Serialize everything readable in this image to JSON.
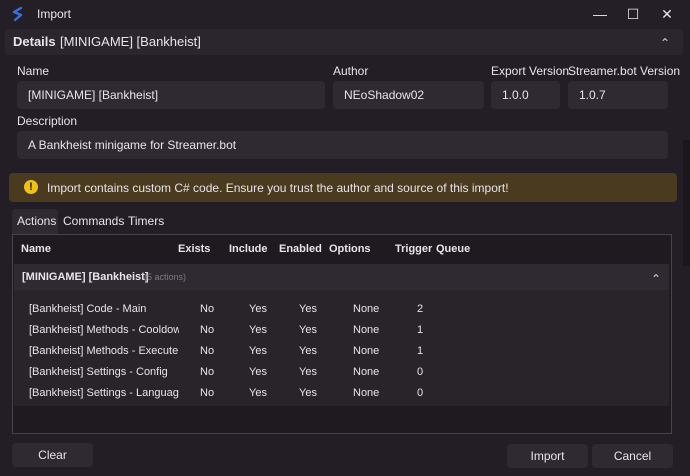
{
  "window": {
    "title": "Import",
    "minimize_glyph": "—",
    "maximize_glyph": "☐",
    "close_glyph": "✕"
  },
  "details": {
    "label": "Details",
    "name": "[MINIGAME] [Bankheist]",
    "collapse_glyph": "⌃"
  },
  "fields": {
    "name_label": "Name",
    "name_value": "[MINIGAME] [Bankheist]",
    "author_label": "Author",
    "author_value": "NEoShadow02",
    "export_version_label": "Export Version",
    "export_version_value": "1.0.0",
    "sb_version_label": "Streamer.bot Version",
    "sb_version_value": "1.0.7",
    "description_label": "Description",
    "description_value": "A Bankheist minigame for Streamer.bot"
  },
  "warning": {
    "icon": "!",
    "text": "Import contains custom C# code. Ensure you trust the author and source of this import!"
  },
  "tabs": [
    {
      "label": "Actions"
    },
    {
      "label": "Commands"
    },
    {
      "label": "Timers"
    }
  ],
  "grid": {
    "columns": [
      "Name",
      "Exists",
      "Include",
      "Enabled",
      "Options",
      "Trigger",
      "Queue"
    ],
    "group": {
      "label": "[MINIGAME] [Bankheist]",
      "count": "(5 actions)",
      "collapse_glyph": "⌃"
    },
    "rows": [
      {
        "name": "[Bankheist] Code - Main",
        "exists": "No",
        "include": "Yes",
        "enabled": "Yes",
        "options": "None",
        "trigger": "2",
        "queue": ""
      },
      {
        "name": "[Bankheist] Methods - Cooldown",
        "exists": "No",
        "include": "Yes",
        "enabled": "Yes",
        "options": "None",
        "trigger": "1",
        "queue": ""
      },
      {
        "name": "[Bankheist] Methods - Execute",
        "exists": "No",
        "include": "Yes",
        "enabled": "Yes",
        "options": "None",
        "trigger": "1",
        "queue": ""
      },
      {
        "name": "[Bankheist] Settings - Config",
        "exists": "No",
        "include": "Yes",
        "enabled": "Yes",
        "options": "None",
        "trigger": "0",
        "queue": ""
      },
      {
        "name": "[Bankheist] Settings - Language",
        "exists": "No",
        "include": "Yes",
        "enabled": "Yes",
        "options": "None",
        "trigger": "0",
        "queue": ""
      }
    ]
  },
  "buttons": {
    "clear": "Clear",
    "import": "Import",
    "cancel": "Cancel"
  },
  "colors": {
    "accent": "#3b6fd9",
    "warning_bg": "#4a3a20",
    "warning_icon": "#f0c020"
  }
}
